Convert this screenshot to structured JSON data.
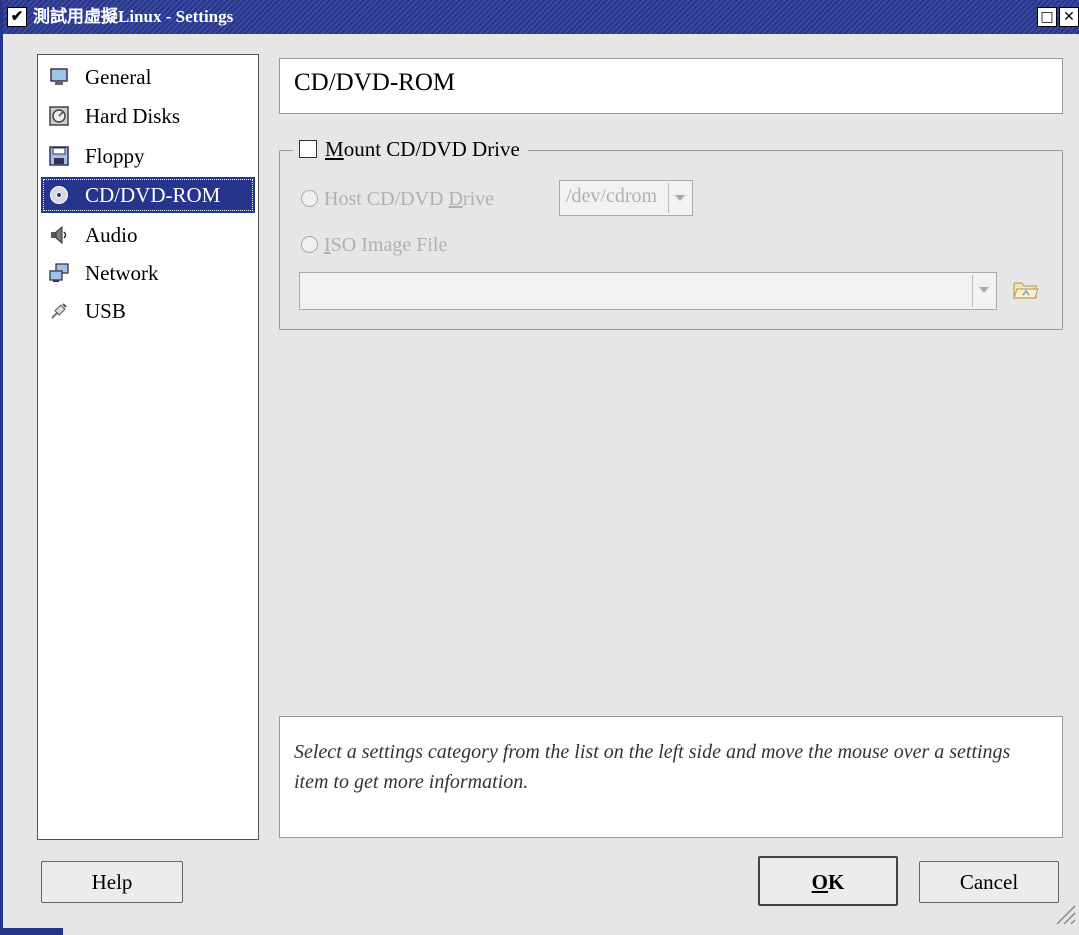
{
  "window": {
    "title": "測試用虛擬Linux - Settings",
    "menu_glyph": "✔",
    "max_glyph": "□",
    "close_glyph": "✕"
  },
  "sidebar": {
    "items": [
      {
        "label": "General",
        "icon": "monitor-icon",
        "selected": false
      },
      {
        "label": "Hard Disks",
        "icon": "hard-disk-icon",
        "selected": false
      },
      {
        "label": "Floppy",
        "icon": "floppy-icon",
        "selected": false
      },
      {
        "label": "CD/DVD-ROM",
        "icon": "cd-icon",
        "selected": true
      },
      {
        "label": "Audio",
        "icon": "speaker-icon",
        "selected": false
      },
      {
        "label": "Network",
        "icon": "network-icon",
        "selected": false
      },
      {
        "label": "USB",
        "icon": "usb-plug-icon",
        "selected": false
      }
    ]
  },
  "page": {
    "title": "CD/DVD-ROM"
  },
  "mount": {
    "checkbox_mnemonic": "M",
    "checkbox_rest": "ount CD/DVD Drive",
    "checked": false,
    "host_radio_pre": "Host CD/DVD ",
    "host_radio_mnemonic": "D",
    "host_radio_post": "rive",
    "host_drive_value": "/dev/cdrom",
    "iso_radio_mnemonic": "I",
    "iso_radio_rest": "SO Image File",
    "iso_path_value": ""
  },
  "description": {
    "text": "Select a settings category from the list on the left side and move the mouse over a settings item to get more information."
  },
  "buttons": {
    "help": "Help",
    "ok_mnemonic": "O",
    "ok_rest": "K",
    "cancel": "Cancel"
  },
  "colors": {
    "selection": "#27348b",
    "titlebar": "#27348b"
  }
}
